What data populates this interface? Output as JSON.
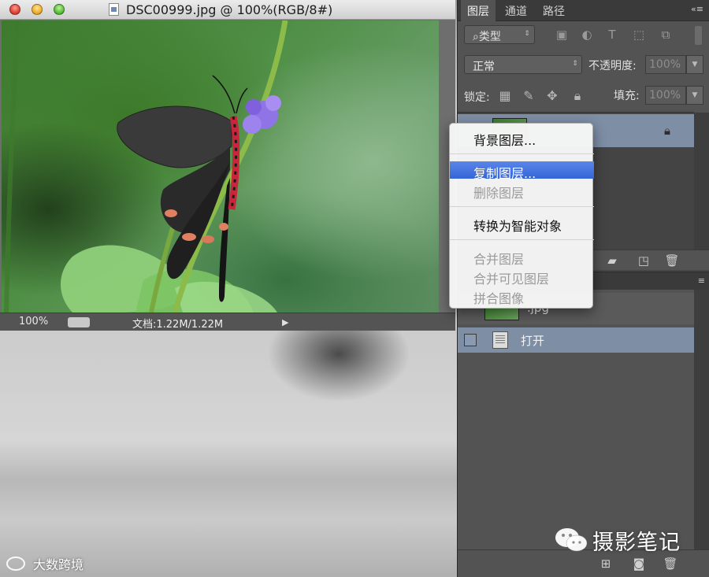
{
  "window": {
    "title": "DSC00999.jpg @ 100%(RGB/8#)"
  },
  "status_bar": {
    "zoom": "100%",
    "doc_size": "文档:1.22M/1.22M",
    "arrow": "▶"
  },
  "layers_panel": {
    "tabs": [
      "图层",
      "通道",
      "路径"
    ],
    "active_tab": "图层",
    "kind_filter": "⌕类型",
    "blend_mode": "正常",
    "opacity_label": "不透明度:",
    "opacity_value": "100%",
    "lock_label": "锁定:",
    "fill_label": "填充:",
    "fill_value": "100%"
  },
  "history_panel": {
    "snapshot_name": ".jpg",
    "items": [
      "打开"
    ]
  },
  "context_menu": {
    "items": [
      {
        "label": "背景图层...",
        "enabled": true
      },
      {
        "label": "复制图层...",
        "enabled": true,
        "highlighted": true
      },
      {
        "label": "删除图层",
        "enabled": false
      },
      {
        "label": "转换为智能对象",
        "enabled": true
      },
      {
        "label": "合并图层",
        "enabled": false
      },
      {
        "label": "合并可见图层",
        "enabled": false
      },
      {
        "label": "拼合图像",
        "enabled": false
      }
    ]
  },
  "watermarks": {
    "left": "大数跨境",
    "right": "摄影笔记"
  },
  "colors": {
    "menu_highlight": "#3465d8",
    "selected_row": "#7d8ea5",
    "panel_bg": "#535353"
  }
}
